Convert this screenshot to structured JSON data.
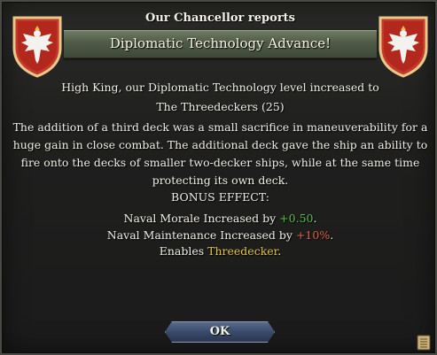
{
  "dialog": {
    "caption": "Our Chancellor reports",
    "title": "Diplomatic Technology Advance!",
    "intro": "High King, our Diplomatic Technology level increased to",
    "tech_name": "The Threedeckers (25)",
    "description": "The addition of a third deck was a small sacrifice in maneuverability for a huge gain in close combat. The additional deck gave the ship an ability to fire onto the decks of smaller two-decker ships, while at the same time protecting its own deck.",
    "bonus_header": "BONUS EFFECT:",
    "effects": [
      {
        "text": "Naval Morale Increased by ",
        "value": "+0.50",
        "suffix": "."
      },
      {
        "text": "Naval Maintenance Increased by ",
        "value": "+10%",
        "suffix": "."
      },
      {
        "text": "Enables ",
        "value": "Threedecker",
        "suffix": "."
      }
    ],
    "ok_label": "OK"
  },
  "icons": {
    "left_emblem": "white-eagle-shield-icon",
    "right_emblem": "white-eagle-shield-icon",
    "corner": "ledger-icon"
  },
  "colors": {
    "positive": "#56c04a",
    "negative": "#e0604c",
    "highlight": "#e2c24a",
    "shield": "#c0392b"
  }
}
